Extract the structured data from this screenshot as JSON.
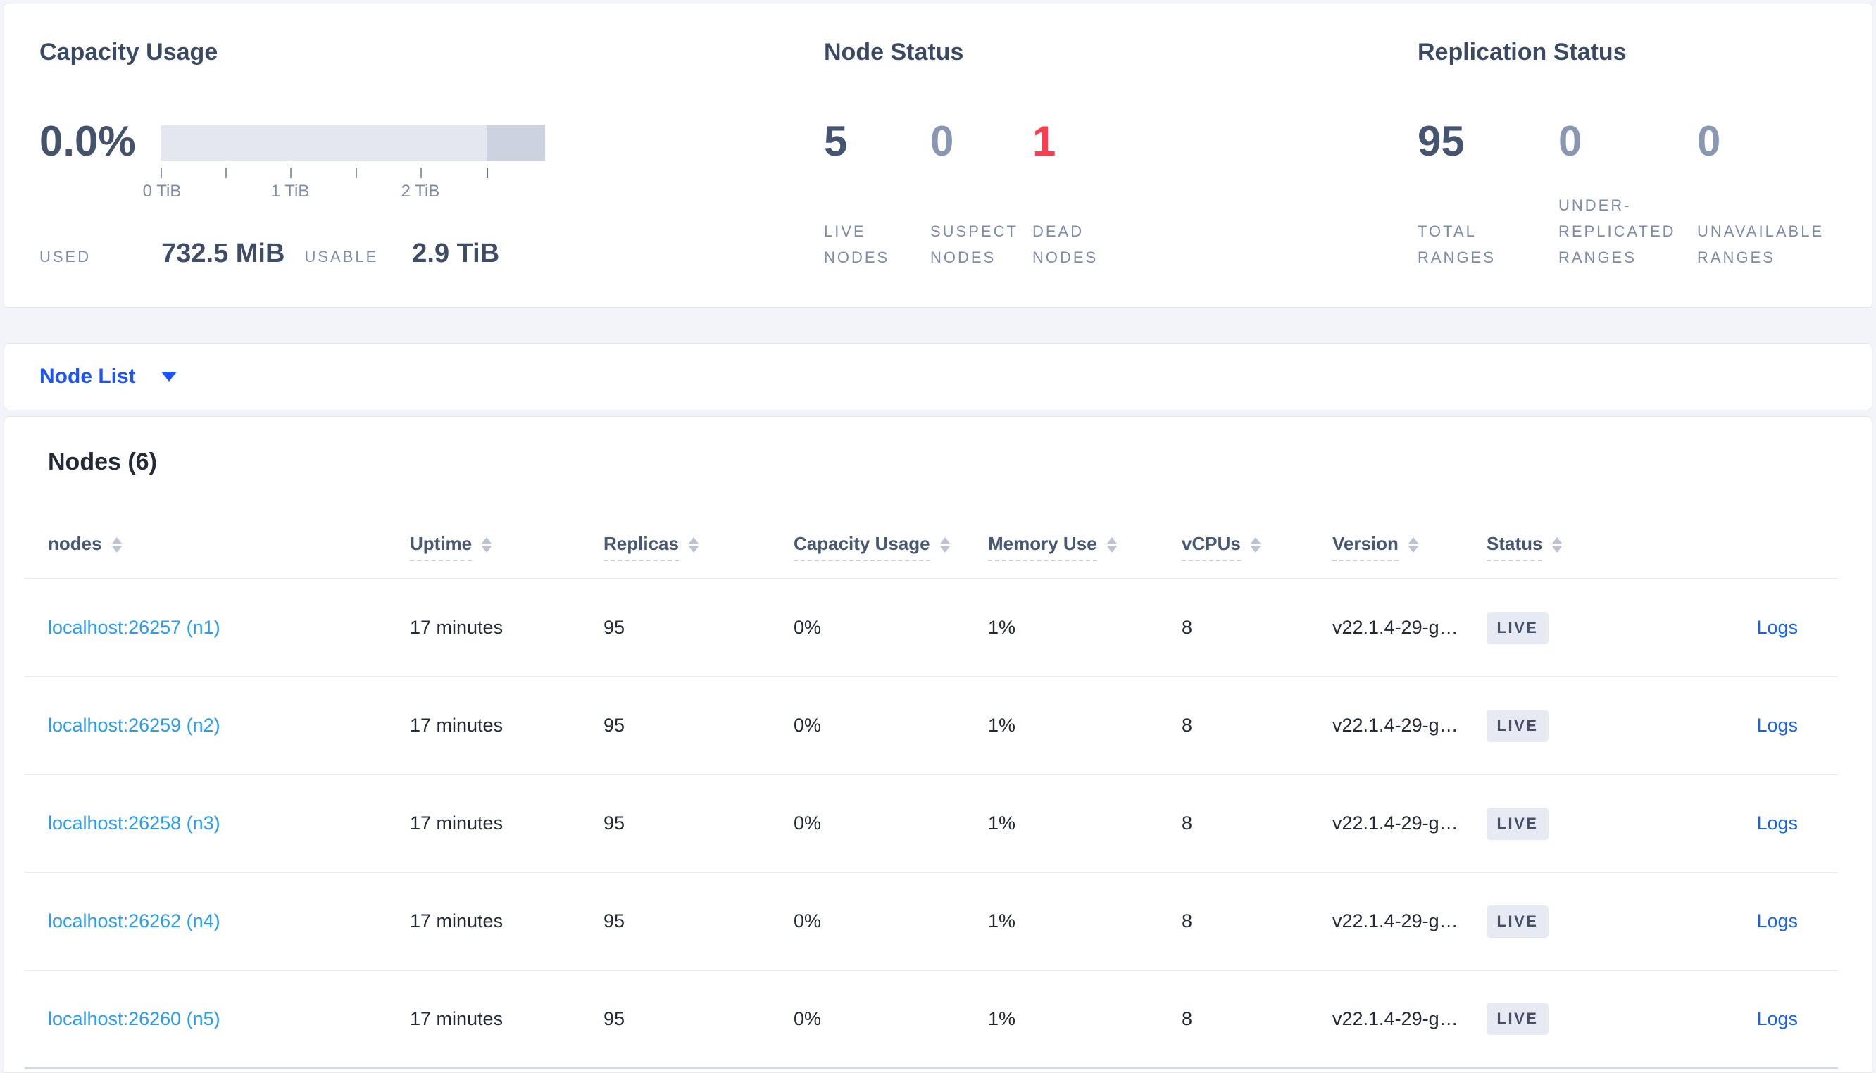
{
  "summary": {
    "capacity": {
      "title": "Capacity Usage",
      "percent": "0.0%",
      "tick_labels": [
        "0 TiB",
        "1 TiB",
        "2 TiB"
      ],
      "axis_max_tib": 2.9,
      "used_label": "USED",
      "used_value": "732.5 MiB",
      "usable_label": "USABLE",
      "usable_value": "2.9 TiB"
    },
    "node_status": {
      "title": "Node Status",
      "stats": [
        {
          "value": "5",
          "label": "LIVE\nNODES",
          "tone": "dark"
        },
        {
          "value": "0",
          "label": "SUSPECT\nNODES",
          "tone": "muted"
        },
        {
          "value": "1",
          "label": "DEAD\nNODES",
          "tone": "danger"
        }
      ]
    },
    "replication": {
      "title": "Replication Status",
      "stats": [
        {
          "value": "95",
          "label": "TOTAL\nRANGES",
          "tone": "dark"
        },
        {
          "value": "0",
          "label": "UNDER-\nREPLICATED\nRANGES",
          "tone": "muted"
        },
        {
          "value": "0",
          "label": "UNAVAILABLE\nRANGES",
          "tone": "muted"
        }
      ]
    }
  },
  "view_selector": {
    "label": "Node List"
  },
  "nodes_section": {
    "heading": "Nodes (6)",
    "logs_label": "Logs",
    "columns": [
      {
        "label": "nodes"
      },
      {
        "label": "Uptime"
      },
      {
        "label": "Replicas"
      },
      {
        "label": "Capacity Usage"
      },
      {
        "label": "Memory Use"
      },
      {
        "label": "vCPUs"
      },
      {
        "label": "Version"
      },
      {
        "label": "Status"
      }
    ],
    "rows": [
      {
        "address": "localhost:26257 (n1)",
        "uptime": "17 minutes",
        "replicas": "95",
        "capacity_usage": "0%",
        "memory_use": "1%",
        "vcpus": "8",
        "version": "v22.1.4-29-g…",
        "status": "LIVE"
      },
      {
        "address": "localhost:26259 (n2)",
        "uptime": "17 minutes",
        "replicas": "95",
        "capacity_usage": "0%",
        "memory_use": "1%",
        "vcpus": "8",
        "version": "v22.1.4-29-g…",
        "status": "LIVE"
      },
      {
        "address": "localhost:26258 (n3)",
        "uptime": "17 minutes",
        "replicas": "95",
        "capacity_usage": "0%",
        "memory_use": "1%",
        "vcpus": "8",
        "version": "v22.1.4-29-g…",
        "status": "LIVE"
      },
      {
        "address": "localhost:26262 (n4)",
        "uptime": "17 minutes",
        "replicas": "95",
        "capacity_usage": "0%",
        "memory_use": "1%",
        "vcpus": "8",
        "version": "v22.1.4-29-g…",
        "status": "LIVE"
      },
      {
        "address": "localhost:26260 (n5)",
        "uptime": "17 minutes",
        "replicas": "95",
        "capacity_usage": "0%",
        "memory_use": "1%",
        "vcpus": "8",
        "version": "v22.1.4-29-g…",
        "status": "LIVE"
      }
    ]
  },
  "colors": {
    "page_background": "#f2f4f9",
    "card_border": "#e3e6ee",
    "heading_slate": "#3b4a63",
    "number_dark": "#46556f",
    "number_muted": "#8997b3",
    "number_danger": "#ff3b4e",
    "muted_label": "#7e8ba6",
    "bar_light": "#e4e7f0",
    "bar_dark": "#ccd2e0",
    "node_link_blue": "#269df4",
    "action_blue": "#1b54f8",
    "badge_background": "#e7eaf2",
    "badge_text": "#44506a"
  }
}
